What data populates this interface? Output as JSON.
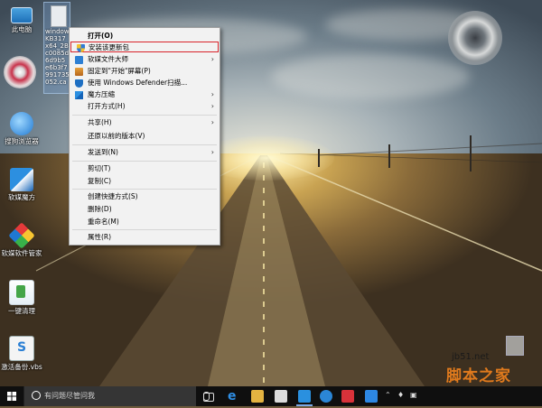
{
  "desktop": {
    "icons": [
      {
        "label": "此电脑",
        "icon": "this-pc-icon"
      },
      {
        "label": "windows6.1-KB31... x64_2BC6... 8c0085df... 6d9... b5c... 73199... 052.cab",
        "icon": "cab-file-icon"
      },
      {
        "label": "搜狗浏览器",
        "icon": "browser-icon"
      },
      {
        "label": "软媒魔方",
        "icon": "rubik-cube-icon"
      },
      {
        "label": "软媒软件管家",
        "icon": "software-manager-icon"
      },
      {
        "label": "一键清理",
        "icon": "cleaner-icon"
      },
      {
        "label": "激活备份.vbs",
        "icon": "script-file-icon"
      }
    ],
    "file_lines": [
      "windows",
      "KB317",
      "x64_2B",
      "c0085d",
      "6d9b5",
      "e6b3f7",
      "991735",
      "052.ca"
    ]
  },
  "context_menu": {
    "items": [
      {
        "label": "打开(O)",
        "bold": true,
        "icon": "",
        "submenu": false
      },
      {
        "label": "安装该更新包",
        "icon": "uac-shield-icon",
        "submenu": false,
        "highlighted": true
      },
      {
        "label": "软媒文件大师",
        "icon": "file-master-icon",
        "submenu": true
      },
      {
        "label": "固定到\"开始\"屏幕(P)",
        "icon": "",
        "submenu": false
      },
      {
        "label": "使用 Windows Defender扫描...",
        "icon": "defender-icon",
        "submenu": false
      },
      {
        "label": "魔方压缩",
        "icon": "rubik-compress-icon",
        "submenu": true
      },
      {
        "label": "打开方式(H)",
        "icon": "",
        "submenu": true
      },
      {
        "label": "共享(H)",
        "icon": "",
        "submenu": true
      },
      {
        "label": "还原以前的版本(V)",
        "icon": "",
        "submenu": false
      },
      {
        "label": "发送到(N)",
        "icon": "",
        "submenu": true
      },
      {
        "label": "剪切(T)",
        "icon": "",
        "submenu": false
      },
      {
        "label": "复制(C)",
        "icon": "",
        "submenu": false
      },
      {
        "label": "创建快捷方式(S)",
        "icon": "",
        "submenu": false
      },
      {
        "label": "删除(D)",
        "icon": "",
        "submenu": false
      },
      {
        "label": "重命名(M)",
        "icon": "",
        "submenu": false
      },
      {
        "label": "属性(R)",
        "icon": "",
        "submenu": false
      }
    ],
    "submenu_arrow": "›"
  },
  "taskbar": {
    "search_placeholder": "有问题尽管问我",
    "apps": [
      "task-view-icon",
      "edge-icon",
      "file-explorer-icon",
      "store-icon",
      "app-blue-icon",
      "ie-icon",
      "app-red-icon",
      "app-green-icon"
    ],
    "tray": [
      "⌃",
      "♦",
      "▣"
    ]
  },
  "watermark": {
    "site": "jb51.net",
    "title": "脚本之家"
  },
  "colors": {
    "highlight_border": "#d8232a",
    "menu_bg": "#f2f2f2",
    "taskbar_bg": "#0f0f0f",
    "watermark_orange": "#e07a1d"
  }
}
